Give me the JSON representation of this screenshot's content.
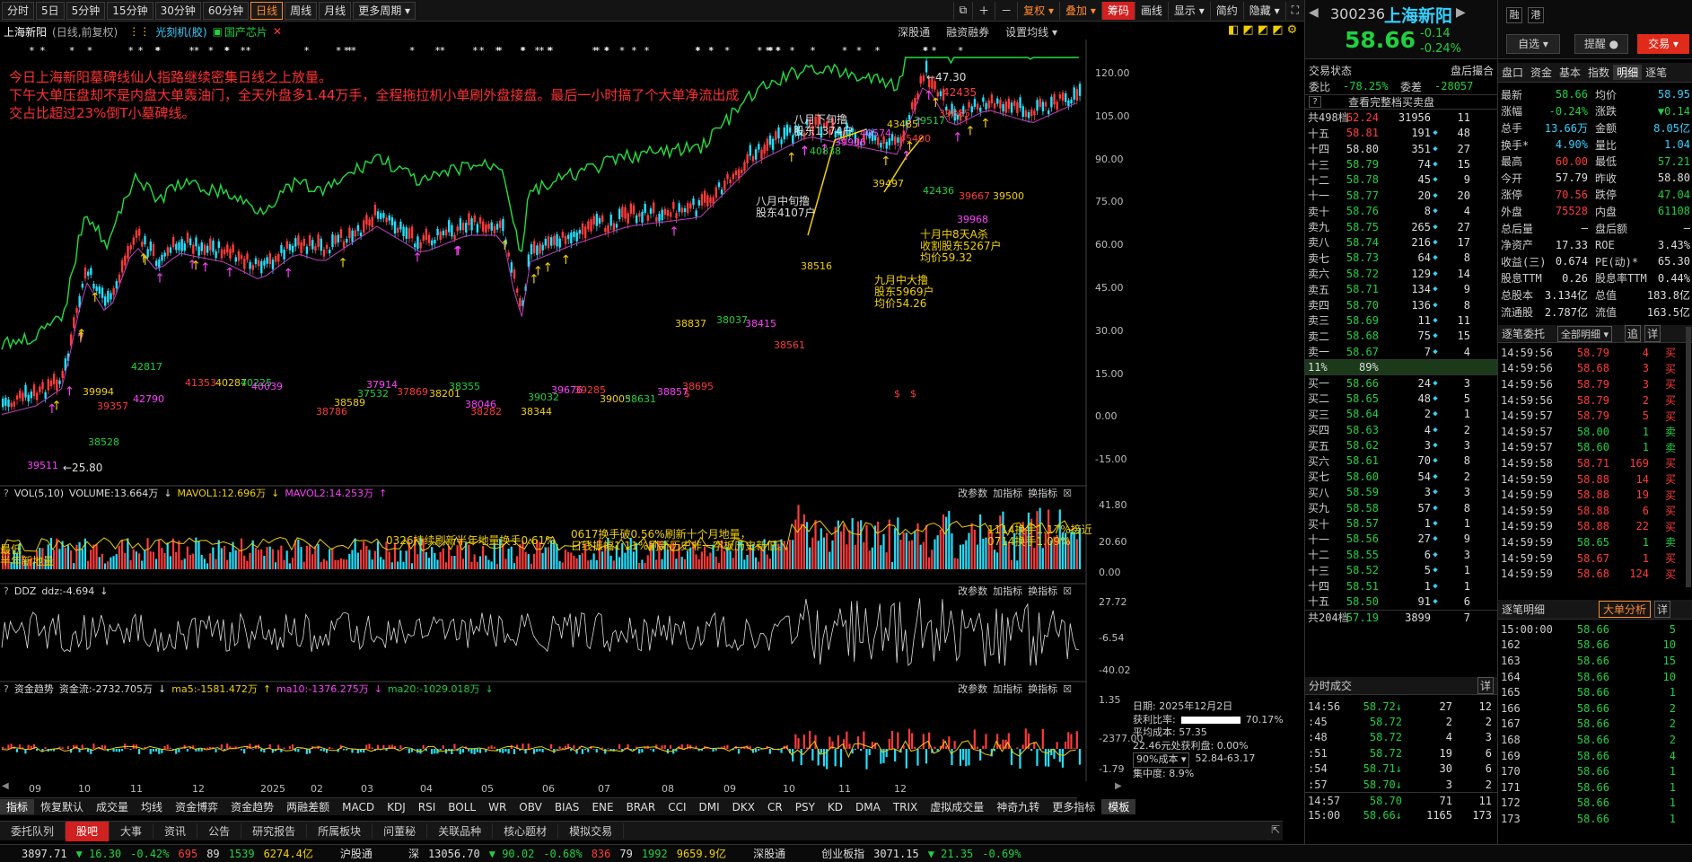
{
  "toolbar": {
    "periods": [
      "分时",
      "5日",
      "5分钟",
      "15分钟",
      "30分钟",
      "60分钟",
      "日线",
      "周线",
      "月线",
      "更多周期 ▾"
    ],
    "active_period": "日线",
    "right_buttons": [
      "复权 ▾",
      "叠加 ▾",
      "筹码",
      "画线",
      "显示 ▾",
      "简约",
      "隐藏 ▾"
    ]
  },
  "chart_title": {
    "name": "上海新阳",
    "mode": "(日线,前复权)",
    "tag1": "光刻机(胶)",
    "tag2": "国产芯片",
    "links": [
      "深股通",
      "融资融券",
      "设置均线 ▾"
    ]
  },
  "annotation_text": [
    "今日上海新阳墓碑线仙人指路继续密集日线之上放量。",
    "下午大单压盘却不是内盘大单轰油门，全天外盘多1.44万手，全程拖拉机小单刷外盘接盘。最后一小时搞了个大单净流出成",
    "交占比超过23%倒T小墓碑线。"
  ],
  "price_axis": [
    "120.00",
    "105.00",
    "90.00",
    "75.00",
    "60.00",
    "45.00",
    "30.00",
    "15.00",
    "0.00",
    "-15.00"
  ],
  "price_labels": {
    "high": "←47.30",
    "low": "←25.80",
    "top": "42435",
    "misc": [
      "42817",
      "42790",
      "41353",
      "40287",
      "40225",
      "40039",
      "39357",
      "39994",
      "38528",
      "39511",
      "38786",
      "38589",
      "37532",
      "37914",
      "37869",
      "38201",
      "38355",
      "38046",
      "38282",
      "38344",
      "39032",
      "39676",
      "39285",
      "39005",
      "38631",
      "38857",
      "38695",
      "38837",
      "38037",
      "38415",
      "38561",
      "38516",
      "40838",
      "40574",
      "45400",
      "39497",
      "42436",
      "39968",
      "39667",
      "43485",
      "39517",
      "39906",
      "39885",
      "39500"
    ],
    "notes": [
      {
        "t": "八月下旬撸\n股东1374户",
        "c": "w"
      },
      {
        "t": "八月中旬撸\n股东4107户",
        "c": "w"
      },
      {
        "t": "九月中大撸\n股东5969户\n均价54.26",
        "c": "y"
      },
      {
        "t": "十月中8天A杀\n收割股东5267户\n均价59.32",
        "c": "y"
      }
    ]
  },
  "vol_panel": {
    "header": [
      "VOL(5,10)",
      "VOLUME:13.664万",
      "↓",
      "MAVOL1:12.696万",
      "↓",
      "MAVOL2:14.253万",
      "↑"
    ],
    "axis": [
      "41.80",
      "20.60",
      "0.00"
    ],
    "notes": [
      "0326持续刷新半年地量换手0.61%",
      "0617换手破0.56%刷新十个月地量，\n日线振幅1.11%刷新历史非一字板历史新低。",
      "1114换手1.17%接近\n0714换手1.09%",
      "最低\n半年新地量"
    ],
    "tools": [
      "改参数",
      "加指标",
      "换指标"
    ]
  },
  "ddz_panel": {
    "header": [
      "DDZ",
      "ddz:-4.694",
      "↓"
    ],
    "axis": [
      "27.72",
      "-6.54",
      "-40.02"
    ],
    "tools": [
      "改参数",
      "加指标",
      "换指标"
    ]
  },
  "fund_panel": {
    "header": [
      "资金趋势",
      "资金流:-2732.705万",
      "↓",
      "ma5:-1581.472万",
      "↑",
      "ma10:-1376.275万",
      "↓",
      "ma20:-1029.018万",
      "↓"
    ],
    "axis": [
      "1.35",
      "-2377.00",
      "-1.79"
    ],
    "tools": [
      "改参数",
      "加指标",
      "换指标"
    ]
  },
  "x_axis": [
    "09",
    "10",
    "11",
    "12",
    "2025",
    "02",
    "03",
    "04",
    "05",
    "06",
    "07",
    "08",
    "09",
    "10",
    "11",
    "12"
  ],
  "chip_info": {
    "date": "日期: 2025年12月2日",
    "profit_label": "获利比率:",
    "profit_value": "70.17%",
    "avg_cost": "平均成本: 57.35",
    "profit_cost": "22.46元处获利盘: 0.00%",
    "cost_mode": "90%成本 ▾",
    "range": "52.84-63.17",
    "concentration": "集中度: 8.9%"
  },
  "indicator_tabs": [
    "指标",
    "恢复默认",
    "成交量",
    "均线",
    "资金博弈",
    "资金趋势",
    "两融差额",
    "MACD",
    "KDJ",
    "RSI",
    "BOLL",
    "WR",
    "OBV",
    "BIAS",
    "ENE",
    "BRAR",
    "CCI",
    "DMI",
    "DKX",
    "CR",
    "PSY",
    "KD",
    "DMA",
    "TRIX",
    "虚拟成交量",
    "神奇九转",
    "更多指标",
    "模板"
  ],
  "bottom_tabs": [
    "委托队列",
    "股吧",
    "大事",
    "资讯",
    "公告",
    "研究报告",
    "所属板块",
    "问董秘",
    "关联品种",
    "核心题材",
    "模拟交易"
  ],
  "active_bottom_tab": "股吧",
  "status": {
    "sh": "3897.71",
    "sh_ch": "▼ 16.30",
    "sh_pct": "-0.42%",
    "sh_n1": "695",
    "sh_n2": "89",
    "sh_n3": "1539",
    "sh_amt": "6274.4亿",
    "hgt": "沪股通",
    "sz_label": "深",
    "sz": "13056.70",
    "sz_ch": "▼ 90.02",
    "sz_pct": "-0.68%",
    "sz_n1": "836",
    "sz_n2": "79",
    "sz_n3": "1992",
    "sz_amt": "9659.9亿",
    "sgt": "深股通",
    "cy": "创业板指",
    "cy_val": "3071.15",
    "cy_ch": "▼ 21.35",
    "cy_pct": "-0.69%"
  },
  "stock": {
    "code": "300236",
    "name": "上海新阳",
    "price": "58.66",
    "change": "-0.14",
    "pct": "-0.24%",
    "btn_rong": "融",
    "btn_gang": "港",
    "btn_zixuan": "自选 ▾",
    "btn_remind": "提醒 ●",
    "btn_trade": "交易 ▾"
  },
  "trade_state": {
    "label": "交易状态",
    "value": "盘后撮合",
    "ratio_label": "委比",
    "ratio": "-78.25%",
    "diff_label": "委差",
    "diff": "-28057",
    "full_book": "查看完整档买卖盘"
  },
  "ask_total": {
    "label": "共498档",
    "price": "62.24",
    "vol": "31956",
    "n": "11"
  },
  "asks": [
    [
      "十五",
      "58.81",
      "191",
      "48"
    ],
    [
      "十四",
      "58.80",
      "351",
      "27"
    ],
    [
      "十三",
      "58.79",
      "74",
      "15"
    ],
    [
      "十二",
      "58.78",
      "45",
      "9"
    ],
    [
      "十一",
      "58.77",
      "20",
      "20"
    ],
    [
      "卖十",
      "58.76",
      "8",
      "4"
    ],
    [
      "卖九",
      "58.75",
      "265",
      "27"
    ],
    [
      "卖八",
      "58.74",
      "216",
      "17"
    ],
    [
      "卖七",
      "58.73",
      "64",
      "8"
    ],
    [
      "卖六",
      "58.72",
      "129",
      "14"
    ],
    [
      "卖五",
      "58.71",
      "134",
      "9"
    ],
    [
      "卖四",
      "58.70",
      "136",
      "8"
    ],
    [
      "卖三",
      "58.69",
      "11",
      "11"
    ],
    [
      "卖二",
      "58.68",
      "75",
      "15"
    ],
    [
      "卖一",
      "58.67",
      "7",
      "4"
    ]
  ],
  "ratio_bar": {
    "left": "11%",
    "right": "89%"
  },
  "bids": [
    [
      "买一",
      "58.66",
      "24",
      "3"
    ],
    [
      "买二",
      "58.65",
      "48",
      "5"
    ],
    [
      "买三",
      "58.64",
      "2",
      "1"
    ],
    [
      "买四",
      "58.63",
      "4",
      "2"
    ],
    [
      "买五",
      "58.62",
      "3",
      "3"
    ],
    [
      "买六",
      "58.61",
      "70",
      "8"
    ],
    [
      "买七",
      "58.60",
      "54",
      "2"
    ],
    [
      "买八",
      "58.59",
      "3",
      "3"
    ],
    [
      "买九",
      "58.58",
      "57",
      "8"
    ],
    [
      "买十",
      "58.57",
      "1",
      "1"
    ],
    [
      "十一",
      "58.56",
      "27",
      "9"
    ],
    [
      "十二",
      "58.55",
      "6",
      "3"
    ],
    [
      "十三",
      "58.52",
      "5",
      "1"
    ],
    [
      "十四",
      "58.51",
      "1",
      "1"
    ],
    [
      "十五",
      "58.50",
      "91",
      "6"
    ]
  ],
  "bid_total": {
    "label": "共204档",
    "price": "57.19",
    "vol": "3899",
    "n": "7"
  },
  "minute_trades": {
    "title": "分时成交",
    "detail": "详",
    "rows": [
      [
        "14:56",
        "58.72↓",
        "27",
        "12"
      ],
      [
        ":45",
        "58.72",
        "2",
        "2"
      ],
      [
        ":48",
        "58.72",
        "4",
        "3"
      ],
      [
        ":51",
        "58.72",
        "19",
        "6"
      ],
      [
        ":54",
        "58.71↓",
        "30",
        "6"
      ],
      [
        ":57",
        "58.70↓",
        "3",
        "2"
      ],
      [
        "14:57",
        "58.70",
        "71",
        "11"
      ],
      [
        "15:00",
        "58.66↓",
        "1165",
        "173"
      ]
    ]
  },
  "quote": [
    [
      "最新",
      "58.66",
      "均价",
      "58.95"
    ],
    [
      "涨幅",
      "-0.24%",
      "涨跌",
      "▼0.14"
    ],
    [
      "总手",
      "13.66万",
      "金额",
      "8.05亿"
    ],
    [
      "换手*",
      "4.90%",
      "量比",
      "1.04"
    ],
    [
      "最高",
      "60.00",
      "最低",
      "57.21"
    ],
    [
      "今开",
      "57.79",
      "昨收",
      "58.80"
    ],
    [
      "涨停",
      "70.56",
      "跌停",
      "47.04"
    ],
    [
      "外盘",
      "75528",
      "内盘",
      "61108"
    ],
    [
      "总后量",
      "—",
      "盘后额",
      "—"
    ],
    [
      "净资产",
      "17.33",
      "ROE",
      "3.43%"
    ],
    [
      "收益(三)",
      "0.674",
      "PE(动)*",
      "65.30"
    ],
    [
      "股息TTM",
      "0.26",
      "股息率TTM",
      "0.44%"
    ],
    [
      "总股本",
      "3.134亿",
      "总值",
      "183.8亿"
    ],
    [
      "流通股",
      "2.787亿",
      "流值",
      "163.5亿"
    ]
  ],
  "right_tabs": [
    "盘口",
    "资金",
    "基本",
    "指数",
    "明细",
    "逐笔"
  ],
  "order_title": "逐笔委托",
  "order_filter": "全部明细 ▾",
  "order_btn1": "追",
  "order_btn2": "详",
  "orders": [
    [
      "14:59:56",
      "58.79",
      "4",
      "买"
    ],
    [
      "14:59:56",
      "58.68",
      "3",
      "买"
    ],
    [
      "14:59:56",
      "58.79",
      "3",
      "买"
    ],
    [
      "14:59:56",
      "58.79",
      "2",
      "买"
    ],
    [
      "14:59:57",
      "58.79",
      "5",
      "买"
    ],
    [
      "14:59:57",
      "58.00",
      "1",
      "卖"
    ],
    [
      "14:59:57",
      "58.60",
      "1",
      "卖"
    ],
    [
      "14:59:58",
      "58.71",
      "169",
      "买"
    ],
    [
      "14:59:59",
      "58.88",
      "14",
      "买"
    ],
    [
      "14:59:59",
      "58.88",
      "19",
      "买"
    ],
    [
      "14:59:59",
      "58.88",
      "6",
      "买"
    ],
    [
      "14:59:59",
      "58.88",
      "22",
      "买"
    ],
    [
      "14:59:59",
      "58.65",
      "1",
      "卖"
    ],
    [
      "14:59:59",
      "58.67",
      "1",
      "买"
    ],
    [
      "14:59:59",
      "58.68",
      "124",
      "买"
    ]
  ],
  "tick_title": "逐笔明细",
  "tick_btn": "大单分析",
  "tick_detail": "详",
  "ticks": [
    [
      "15:00:00",
      "58.66",
      "5"
    ],
    [
      "162",
      "58.66",
      "10"
    ],
    [
      "163",
      "58.66",
      "15"
    ],
    [
      "164",
      "58.66",
      "10"
    ],
    [
      "165",
      "58.66",
      "1"
    ],
    [
      "166",
      "58.66",
      "2"
    ],
    [
      "167",
      "58.66",
      "2"
    ],
    [
      "168",
      "58.66",
      "2"
    ],
    [
      "169",
      "58.66",
      "4"
    ],
    [
      "170",
      "58.66",
      "1"
    ],
    [
      "171",
      "58.66",
      "1"
    ],
    [
      "172",
      "58.66",
      "1"
    ],
    [
      "173",
      "58.66",
      "1"
    ]
  ]
}
